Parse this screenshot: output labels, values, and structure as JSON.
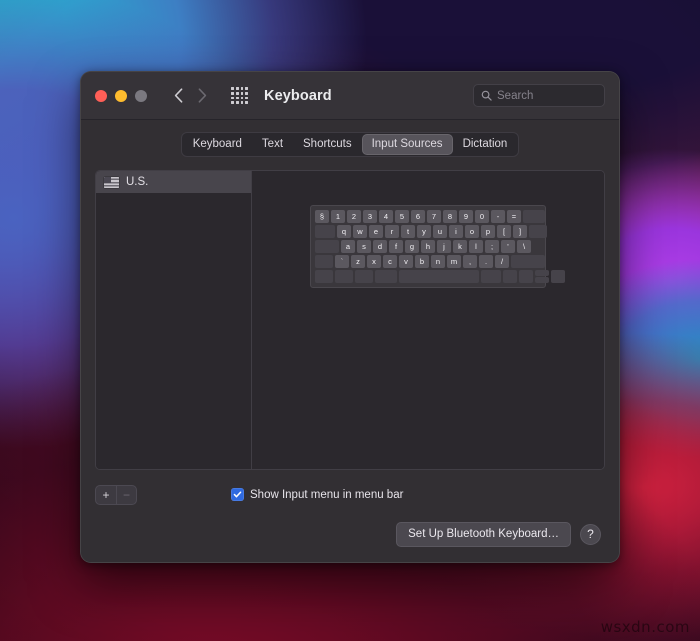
{
  "desktop": {
    "watermark": "wsxdn.com"
  },
  "window": {
    "title": "Keyboard",
    "traffic": {
      "close": "close-button",
      "minimize": "minimize-button",
      "zoom": "zoom-button"
    },
    "nav": {
      "back": "back-button",
      "forward": "forward-button",
      "grid": "show-all-button"
    },
    "search": {
      "value": "",
      "placeholder": "Search"
    }
  },
  "tabs": [
    {
      "label": "Keyboard",
      "active": false
    },
    {
      "label": "Text",
      "active": false
    },
    {
      "label": "Shortcuts",
      "active": false
    },
    {
      "label": "Input Sources",
      "active": true
    },
    {
      "label": "Dictation",
      "active": false
    }
  ],
  "input_sources": [
    {
      "label": "U.S.",
      "flag": "us-flag-icon",
      "selected": true
    }
  ],
  "list_controls": {
    "add_label": "+",
    "remove_label": "−"
  },
  "checkbox": {
    "label": "Show Input menu in menu bar",
    "checked": true
  },
  "footer": {
    "bluetooth_label": "Set Up Bluetooth Keyboard…",
    "help_label": "?"
  },
  "keyboard_preview": {
    "rows": [
      [
        "§",
        "1",
        "2",
        "3",
        "4",
        "5",
        "6",
        "7",
        "8",
        "9",
        "0",
        "-",
        "=",
        ""
      ],
      [
        "",
        "q",
        "w",
        "e",
        "r",
        "t",
        "y",
        "u",
        "i",
        "o",
        "p",
        "[",
        "]",
        ""
      ],
      [
        "",
        "a",
        "s",
        "d",
        "f",
        "g",
        "h",
        "j",
        "k",
        "l",
        ";",
        "'",
        "\\"
      ],
      [
        "",
        "`",
        "z",
        "x",
        "c",
        "v",
        "b",
        "n",
        "m",
        ",",
        ".",
        "/",
        ""
      ],
      [
        "",
        "",
        "",
        "",
        "",
        "",
        "",
        "",
        "",
        ""
      ]
    ]
  },
  "colors": {
    "window_bg": "#322f33",
    "titlebar_bg": "#363338",
    "panel_bg": "#2b282d",
    "accent_checkbox": "#2f6ae0",
    "selected_row": "#48454c",
    "active_tab": "#57545b",
    "key_fill": "#5b585f",
    "traffic_red": "#ff5f57",
    "traffic_yellow": "#febc2e",
    "traffic_gray": "#7b7980"
  }
}
